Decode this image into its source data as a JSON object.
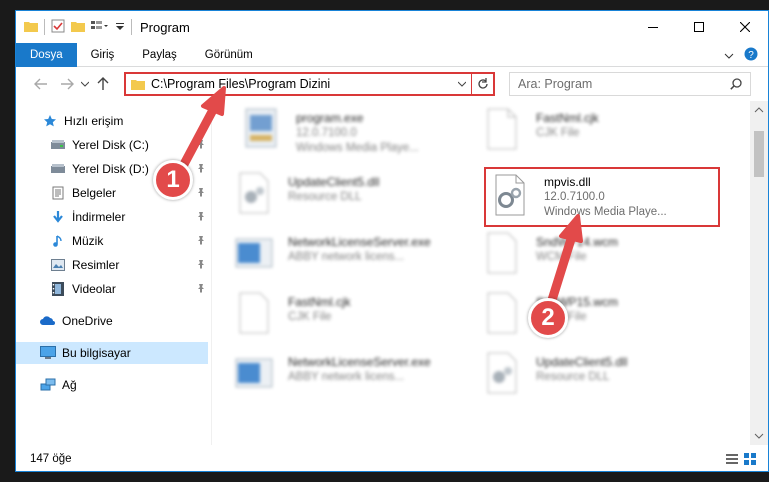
{
  "window": {
    "title": "Program",
    "accent": "#1979ca",
    "highlight_color": "#d93838"
  },
  "ribbon": {
    "tabs": [
      {
        "label": "Dosya",
        "active": true
      },
      {
        "label": "Giriş",
        "active": false
      },
      {
        "label": "Paylaş",
        "active": false
      },
      {
        "label": "Görünüm",
        "active": false
      }
    ]
  },
  "address": {
    "path": "C:\\Program Files\\Program Dizini"
  },
  "search": {
    "placeholder": "Ara: Program"
  },
  "sidebar": {
    "items": [
      {
        "label": "Hızlı erişim",
        "icon": "star-icon",
        "pinned": false
      },
      {
        "label": "Yerel Disk (C:)",
        "icon": "drive-icon",
        "pinned": true
      },
      {
        "label": "Yerel Disk (D:)",
        "icon": "drive-icon",
        "pinned": true
      },
      {
        "label": "Belgeler",
        "icon": "documents-icon",
        "pinned": true
      },
      {
        "label": "İndirmeler",
        "icon": "download-icon",
        "pinned": true
      },
      {
        "label": "Müzik",
        "icon": "music-icon",
        "pinned": true
      },
      {
        "label": "Resimler",
        "icon": "pictures-icon",
        "pinned": true
      },
      {
        "label": "Videolar",
        "icon": "videos-icon",
        "pinned": true
      },
      {
        "label": "OneDrive",
        "icon": "cloud-icon",
        "pinned": false
      },
      {
        "label": "Bu bilgisayar",
        "icon": "computer-icon",
        "pinned": false,
        "selected": true
      },
      {
        "label": "Ağ",
        "icon": "network-icon",
        "pinned": false
      }
    ]
  },
  "files": [
    {
      "name": "program.exe",
      "line1": "12.0.7100.0",
      "line2": "Windows Media Playe...",
      "kind": "exe"
    },
    {
      "name": "FastNml.cjk",
      "line1": "CJK File",
      "line2": "",
      "kind": "blank"
    },
    {
      "name": "UpdateClient5.dll",
      "line1": "Resource DLL",
      "line2": "",
      "kind": "dll"
    },
    {
      "name": "mpvis.dll",
      "line1": "12.0.7100.0",
      "line2": "Windows Media Playe...",
      "kind": "dll"
    },
    {
      "name": "NetworkLicenseServer.exe",
      "line1": "ABBY network licens...",
      "line2": "",
      "kind": "app"
    },
    {
      "name": "SndWP14.wcm",
      "line1": "WCM File",
      "line2": "",
      "kind": "blank"
    },
    {
      "name": "FastNml.cjk",
      "line1": "CJK File",
      "line2": "",
      "kind": "blank"
    },
    {
      "name": "SndWP15.wcm",
      "line1": "WCM File",
      "line2": "",
      "kind": "blank"
    },
    {
      "name": "NetworkLicenseServer.exe",
      "line1": "ABBY network licens...",
      "line2": "",
      "kind": "app"
    },
    {
      "name": "UpdateClient5.dll",
      "line1": "Resource DLL",
      "line2": "",
      "kind": "dll"
    }
  ],
  "status": {
    "count": "147 öğe"
  },
  "annotations": {
    "step1": "1",
    "step2": "2"
  }
}
